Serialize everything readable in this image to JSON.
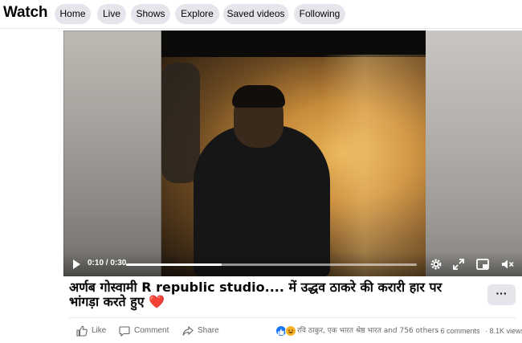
{
  "header": {
    "title": "Watch",
    "tabs": [
      {
        "label": "Home"
      },
      {
        "label": "Live"
      },
      {
        "label": "Shows"
      },
      {
        "label": "Explore"
      },
      {
        "label": "Saved videos"
      },
      {
        "label": "Following"
      }
    ]
  },
  "player": {
    "time_display": "0:10 / 0:30",
    "progress_fraction": 0.33,
    "icons": [
      "play-icon",
      "settings-icon",
      "fullscreen-icon",
      "miniplayer-icon",
      "mute-icon"
    ]
  },
  "post": {
    "title": "अर्णब गोस्वामी R republic studio.... में उद्धव ठाकरे की करारी हार पर भांगड़ा करते हुए",
    "title_emoji": "❤️",
    "more_label": "···"
  },
  "actions": {
    "like_label": "Like",
    "comment_label": "Comment",
    "share_label": "Share"
  },
  "stats": {
    "reactions_text": "रवि ठाकुर, एक भारत श्रेष्ठ भारत and 756 others",
    "separator1": "·",
    "comments": "6 comments",
    "separator2": "·",
    "views": "8.1K views"
  },
  "colors": {
    "tab_bg": "#e4e6eb",
    "secondary_text": "#65676b",
    "like_blue": "#1877f2",
    "haha_yellow": "#f7b125",
    "heart_red": "#e0245e"
  }
}
